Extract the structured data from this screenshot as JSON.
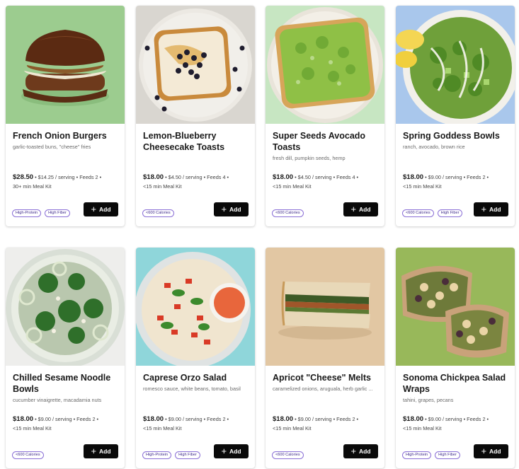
{
  "cards": [
    {
      "title": "French Onion Burgers",
      "subtitle": "garlic-toasted buns, \"cheese\" fries",
      "price": "$28.50",
      "details": "• $14.25 / serving • Feeds 2 •",
      "time": "30+ min Meal Kit",
      "tags": [
        "High-Protein",
        "High Fiber"
      ],
      "add_label": "Add",
      "image_bg": "#9ccc8f"
    },
    {
      "title": "Lemon-Blueberry Cheesecake Toasts",
      "subtitle": "",
      "price": "$18.00",
      "details": "• $4.50 / serving • Feeds 4 •",
      "time": "<15 min Meal Kit",
      "tags": [
        "<600 Calories"
      ],
      "add_label": "Add",
      "image_bg": "#d9d6d0"
    },
    {
      "title": "Super Seeds Avocado Toasts",
      "subtitle": "fresh dill, pumpkin seeds, hemp",
      "price": "$18.00",
      "details": "• $4.50 / serving • Feeds 4 •",
      "time": "<15 min Meal Kit",
      "tags": [
        "<600 Calories"
      ],
      "add_label": "Add",
      "image_bg": "#c7e6c2"
    },
    {
      "title": "Spring Goddess Bowls",
      "subtitle": "ranch, avocado, brown rice",
      "price": "$18.00",
      "details": "• $9.00 / serving • Feeds 2 •",
      "time": "<15 min Meal Kit",
      "tags": [
        "<600 Calories",
        "High Fiber"
      ],
      "add_label": "Add",
      "image_bg": "#a9c7ec"
    },
    {
      "title": "Chilled Sesame Noodle Bowls",
      "subtitle": "cucumber vinaigrette, macadamia nuts",
      "price": "$18.00",
      "details": "• $9.00 / serving • Feeds 2 •",
      "time": "<15 min Meal Kit",
      "tags": [
        "<600 Calories"
      ],
      "add_label": "Add",
      "image_bg": "#eeeeec"
    },
    {
      "title": "Caprese Orzo Salad",
      "subtitle": "romesco sauce, white beans, tomato, basil",
      "price": "$18.00",
      "details": "• $9.00 / serving • Feeds 2 •",
      "time": "<15 min Meal Kit",
      "tags": [
        "High-Protein",
        "High Fiber"
      ],
      "add_label": "Add",
      "image_bg": "#8fd6da"
    },
    {
      "title": "Apricot \"Cheese\" Melts",
      "subtitle": "caramelized onions, aruguala, herb garlic ...",
      "price": "$18.00",
      "details": "• $9.00 / serving • Feeds 2 •",
      "time": "<15 min Meal Kit",
      "tags": [
        "<600 Calories"
      ],
      "add_label": "Add",
      "image_bg": "#e2c7a3"
    },
    {
      "title": "Sonoma Chickpea Salad Wraps",
      "subtitle": "tahini, grapes, pecans",
      "price": "$18.00",
      "details": "• $9.00 / serving • Feeds 2 •",
      "time": "<15 min Meal Kit",
      "tags": [
        "High-Protein",
        "High Fiber"
      ],
      "add_label": "Add",
      "image_bg": "#98b85a"
    }
  ],
  "accent": "#8a6fd6"
}
